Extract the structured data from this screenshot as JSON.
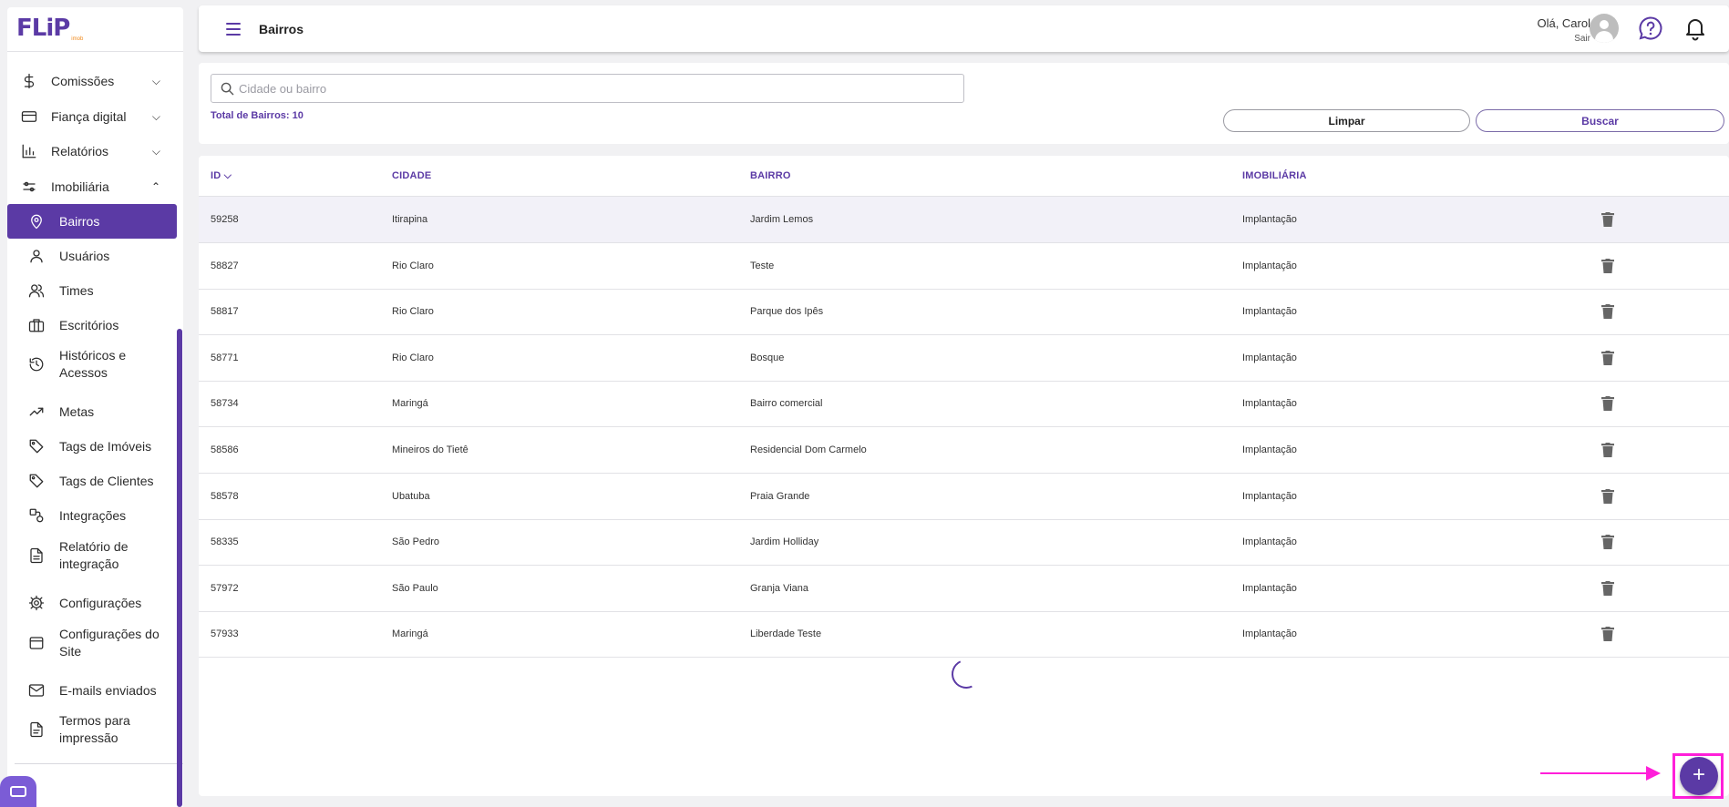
{
  "brand": {
    "logo": "FLiP",
    "logo_sub": "imob"
  },
  "sidebar": {
    "sections": [
      {
        "label": "Comissões",
        "icon": "dollar-icon",
        "expanded": false
      },
      {
        "label": "Fiança digital",
        "icon": "credit-card-icon",
        "expanded": false
      },
      {
        "label": "Relatórios",
        "icon": "bar-chart-icon",
        "expanded": false
      },
      {
        "label": "Imobiliária",
        "icon": "sliders-icon",
        "expanded": true
      }
    ],
    "items": [
      {
        "label": "Bairros",
        "icon": "map-pin-icon",
        "active": true
      },
      {
        "label": "Usuários",
        "icon": "user-icon"
      },
      {
        "label": "Times",
        "icon": "users-icon"
      },
      {
        "label": "Escritórios",
        "icon": "briefcase-icon"
      },
      {
        "label_1": "Históricos e",
        "label_2": "Acessos",
        "icon": "history-icon"
      },
      {
        "label": "Metas",
        "icon": "trending-up-icon"
      },
      {
        "label": "Tags de Imóveis",
        "icon": "tag-icon"
      },
      {
        "label": "Tags de Clientes",
        "icon": "tag-icon"
      },
      {
        "label": "Integrações",
        "icon": "integration-icon"
      },
      {
        "label_1": "Relatório de",
        "label_2": "integração",
        "icon": "file-icon"
      },
      {
        "label": "Configurações",
        "icon": "gear-icon"
      },
      {
        "label_1": "Configurações do",
        "label_2": "Site",
        "icon": "window-icon"
      },
      {
        "label": "E-mails enviados",
        "icon": "mail-icon"
      },
      {
        "label_1": "Termos para",
        "label_2": "impressão",
        "icon": "document-icon"
      }
    ]
  },
  "header": {
    "title": "Bairros",
    "greeting": "Olá, Carol",
    "logout": "Sair"
  },
  "filters": {
    "search_placeholder": "Cidade ou bairro",
    "search_value": "",
    "total_label": "Total de Bairros: 10",
    "clear_label": "Limpar",
    "search_label": "Buscar"
  },
  "table": {
    "columns": [
      "ID",
      "CIDADE",
      "BAIRRO",
      "IMOBILIÁRIA"
    ],
    "rows": [
      {
        "id": "59258",
        "cidade": "Itirapina",
        "bairro": "Jardim Lemos",
        "imobiliaria": "Implantação"
      },
      {
        "id": "58827",
        "cidade": "Rio Claro",
        "bairro": "Teste",
        "imobiliaria": "Implantação"
      },
      {
        "id": "58817",
        "cidade": "Rio Claro",
        "bairro": "Parque dos Ipês",
        "imobiliaria": "Implantação"
      },
      {
        "id": "58771",
        "cidade": "Rio Claro",
        "bairro": "Bosque",
        "imobiliaria": "Implantação"
      },
      {
        "id": "58734",
        "cidade": "Maringá",
        "bairro": "Bairro comercial",
        "imobiliaria": "Implantação"
      },
      {
        "id": "58586",
        "cidade": "Mineiros do Tietê",
        "bairro": "Residencial Dom Carmelo",
        "imobiliaria": "Implantação"
      },
      {
        "id": "58578",
        "cidade": "Ubatuba",
        "bairro": "Praia Grande",
        "imobiliaria": "Implantação"
      },
      {
        "id": "58335",
        "cidade": "São Pedro",
        "bairro": "Jardim Holliday",
        "imobiliaria": "Implantação"
      },
      {
        "id": "57972",
        "cidade": "São Paulo",
        "bairro": "Granja Viana",
        "imobiliaria": "Implantação"
      },
      {
        "id": "57933",
        "cidade": "Maringá",
        "bairro": "Liberdade Teste",
        "imobiliaria": "Implantação"
      }
    ]
  },
  "fab": {
    "label": "+"
  },
  "colors": {
    "primary": "#5b3aa5",
    "annotation": "#ff1fd9",
    "accent": "#f08a1c"
  }
}
